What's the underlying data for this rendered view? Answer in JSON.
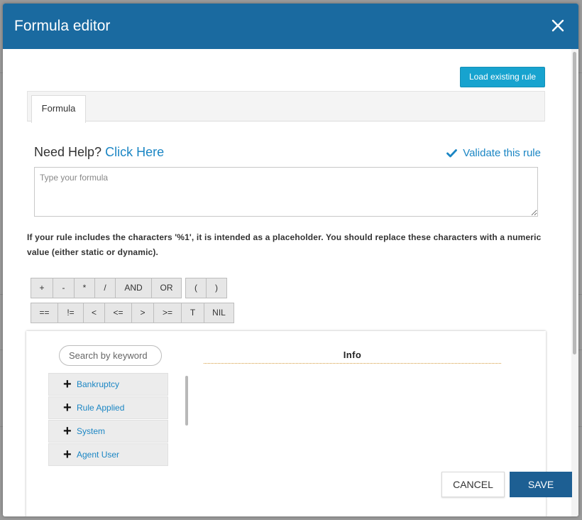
{
  "modal": {
    "title": "Formula editor",
    "close_icon": "close-icon"
  },
  "toolbar": {
    "load_rule_label": "Load existing rule"
  },
  "tabs": [
    {
      "label": "Formula",
      "active": true
    }
  ],
  "help": {
    "prefix": "Need Help?",
    "link": "Click Here",
    "validate_label": "Validate this rule",
    "validate_icon": "checkmark-icon"
  },
  "formula": {
    "placeholder": "Type your formula",
    "value": ""
  },
  "note": "If your rule includes the characters '%1', it is intended as a placeholder. You should replace these characters with a numeric value (either static or dynamic).",
  "operators": {
    "row1_group1": [
      "+",
      "-",
      "*",
      "/",
      "AND",
      "OR"
    ],
    "row1_group2": [
      "(",
      ")"
    ],
    "row2": [
      "==",
      "!=",
      "<",
      "<=",
      ">",
      ">=",
      "T",
      "NIL"
    ]
  },
  "panel": {
    "search_placeholder": "Search by keyword",
    "categories": [
      {
        "label": "Bankruptcy",
        "icon": "plus-icon"
      },
      {
        "label": "Rule Applied",
        "icon": "plus-icon"
      },
      {
        "label": "System",
        "icon": "plus-icon"
      },
      {
        "label": "Agent User",
        "icon": "plus-icon"
      }
    ],
    "info_title": "Info"
  },
  "footer": {
    "cancel_label": "CANCEL",
    "save_label": "SAVE"
  },
  "colors": {
    "header": "#1a6aa0",
    "accent": "#1b86c4",
    "load_button": "#17a3cf",
    "save_button": "#1d5f93"
  }
}
